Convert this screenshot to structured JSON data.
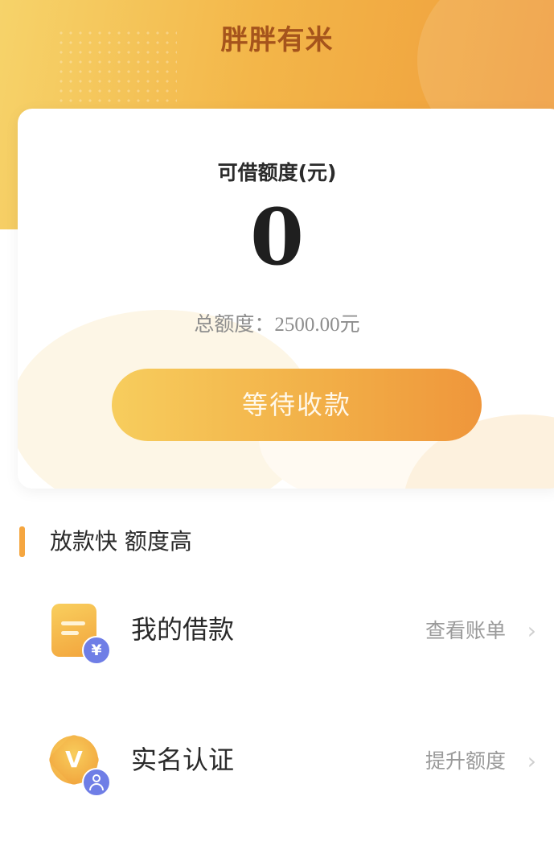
{
  "app": {
    "title": "胖胖有米"
  },
  "credit": {
    "label": "可借额度(元)",
    "value": "0",
    "total_prefix": "总额度：",
    "total_amount": "2500.00",
    "total_unit": "元",
    "button_label": "等待收款"
  },
  "section": {
    "title": "放款快 额度高"
  },
  "menu": [
    {
      "label": "我的借款",
      "action": "查看账单",
      "icon": "loan-document-icon"
    },
    {
      "label": "实名认证",
      "action": "提升额度",
      "icon": "verified-badge-icon"
    }
  ],
  "colors": {
    "accent": "#f3b649",
    "accent_dark": "#ef963b",
    "title_text": "#a5541c",
    "badge_blue": "#6f7ee6"
  }
}
